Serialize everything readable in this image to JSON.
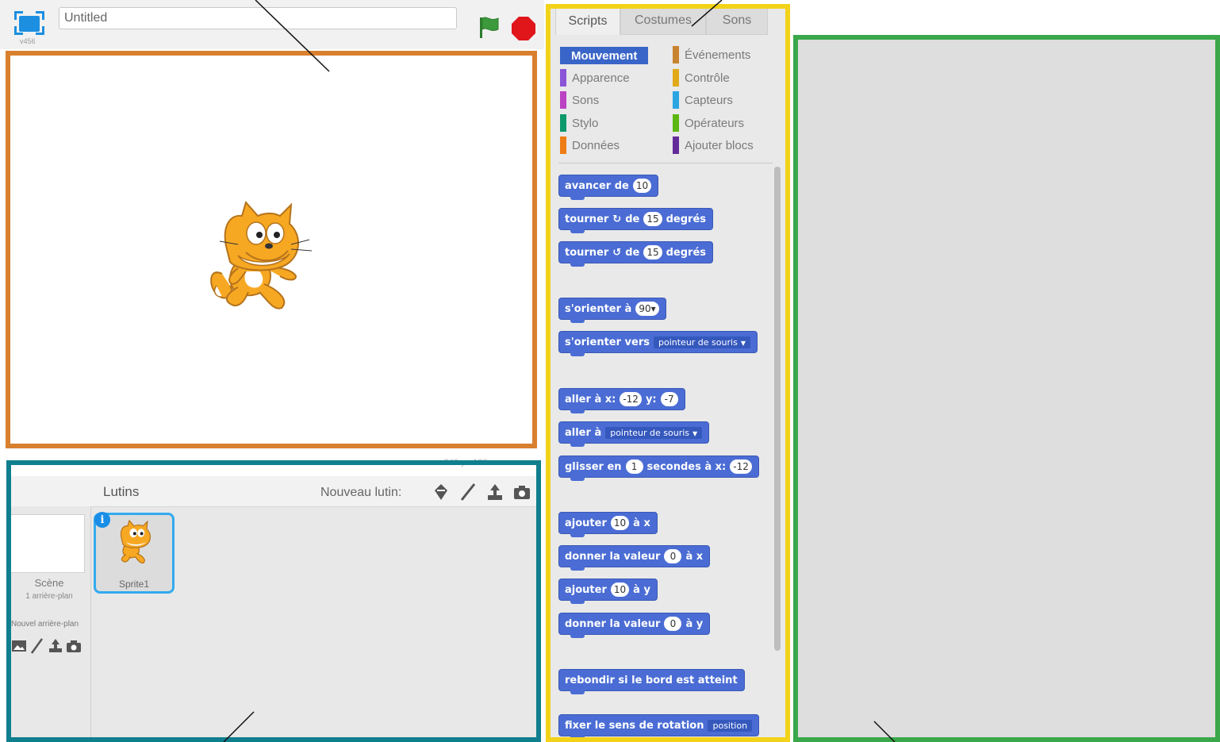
{
  "topbar": {
    "version": "v456",
    "project_title": "Untitled"
  },
  "stage": {
    "coords": "x: 240  y: -180"
  },
  "sprites": {
    "title": "Lutins",
    "new_sprite_label": "Nouveau lutin:",
    "scene_label": "Scène",
    "scene_count": "1 arrière-plan",
    "new_backdrop_label": "Nouvel arrière-plan",
    "sprite_name": "Sprite1",
    "info_badge": "i"
  },
  "palette": {
    "tabs": [
      "Scripts",
      "Costumes",
      "Sons"
    ],
    "categories_left": [
      {
        "label": "Mouvement",
        "color": "#4a6cd4"
      },
      {
        "label": "Apparence",
        "color": "#8a55d7"
      },
      {
        "label": "Sons",
        "color": "#bb42c3"
      },
      {
        "label": "Stylo",
        "color": "#0e9a6c"
      },
      {
        "label": "Données",
        "color": "#ee7d16"
      }
    ],
    "categories_right": [
      {
        "label": "Événements",
        "color": "#c88330"
      },
      {
        "label": "Contrôle",
        "color": "#e1a91a"
      },
      {
        "label": "Capteurs",
        "color": "#2ca5e2"
      },
      {
        "label": "Opérateurs",
        "color": "#5cb712"
      },
      {
        "label": "Ajouter blocs",
        "color": "#632d99"
      }
    ],
    "blocks": {
      "move": {
        "text": "avancer de",
        "steps": "10"
      },
      "turn_right": {
        "text1": "tourner",
        "glyph": "↻",
        "text2": "de",
        "degrees": "15",
        "text3": "degrés"
      },
      "turn_left": {
        "text1": "tourner",
        "glyph": "↺",
        "text2": "de",
        "degrees": "15",
        "text3": "degrés"
      },
      "point_direction": {
        "text": "s'orienter à",
        "value": "90▾"
      },
      "point_towards": {
        "text": "s'orienter vers",
        "value": "pointeur de souris"
      },
      "go_to_xy": {
        "text": "aller à x:",
        "x": "-12",
        "ylabel": "y:",
        "y": "-7"
      },
      "go_to": {
        "text": "aller à",
        "value": "pointeur de souris"
      },
      "glide": {
        "text1": "glisser en",
        "secs": "1",
        "text2": "secondes à x:",
        "x": "-12"
      },
      "change_x": {
        "text1": "ajouter",
        "value": "10",
        "text2": "à x"
      },
      "set_x": {
        "text1": "donner la valeur",
        "value": "0",
        "text2": "à x"
      },
      "change_y": {
        "text1": "ajouter",
        "value": "10",
        "text2": "à y"
      },
      "set_y": {
        "text1": "donner la valeur",
        "value": "0",
        "text2": "à y"
      },
      "bounce": {
        "text": "rebondir si le bord est atteint"
      },
      "rotation_style": {
        "text": "fixer le sens de rotation",
        "value": "position"
      }
    }
  },
  "colors": {
    "frame_stage": "#d9802e",
    "frame_sprites": "#0f7f8e",
    "frame_palette": "#f2d31a",
    "frame_script": "#3aa84a",
    "motion_block": "#4a6cd4"
  }
}
